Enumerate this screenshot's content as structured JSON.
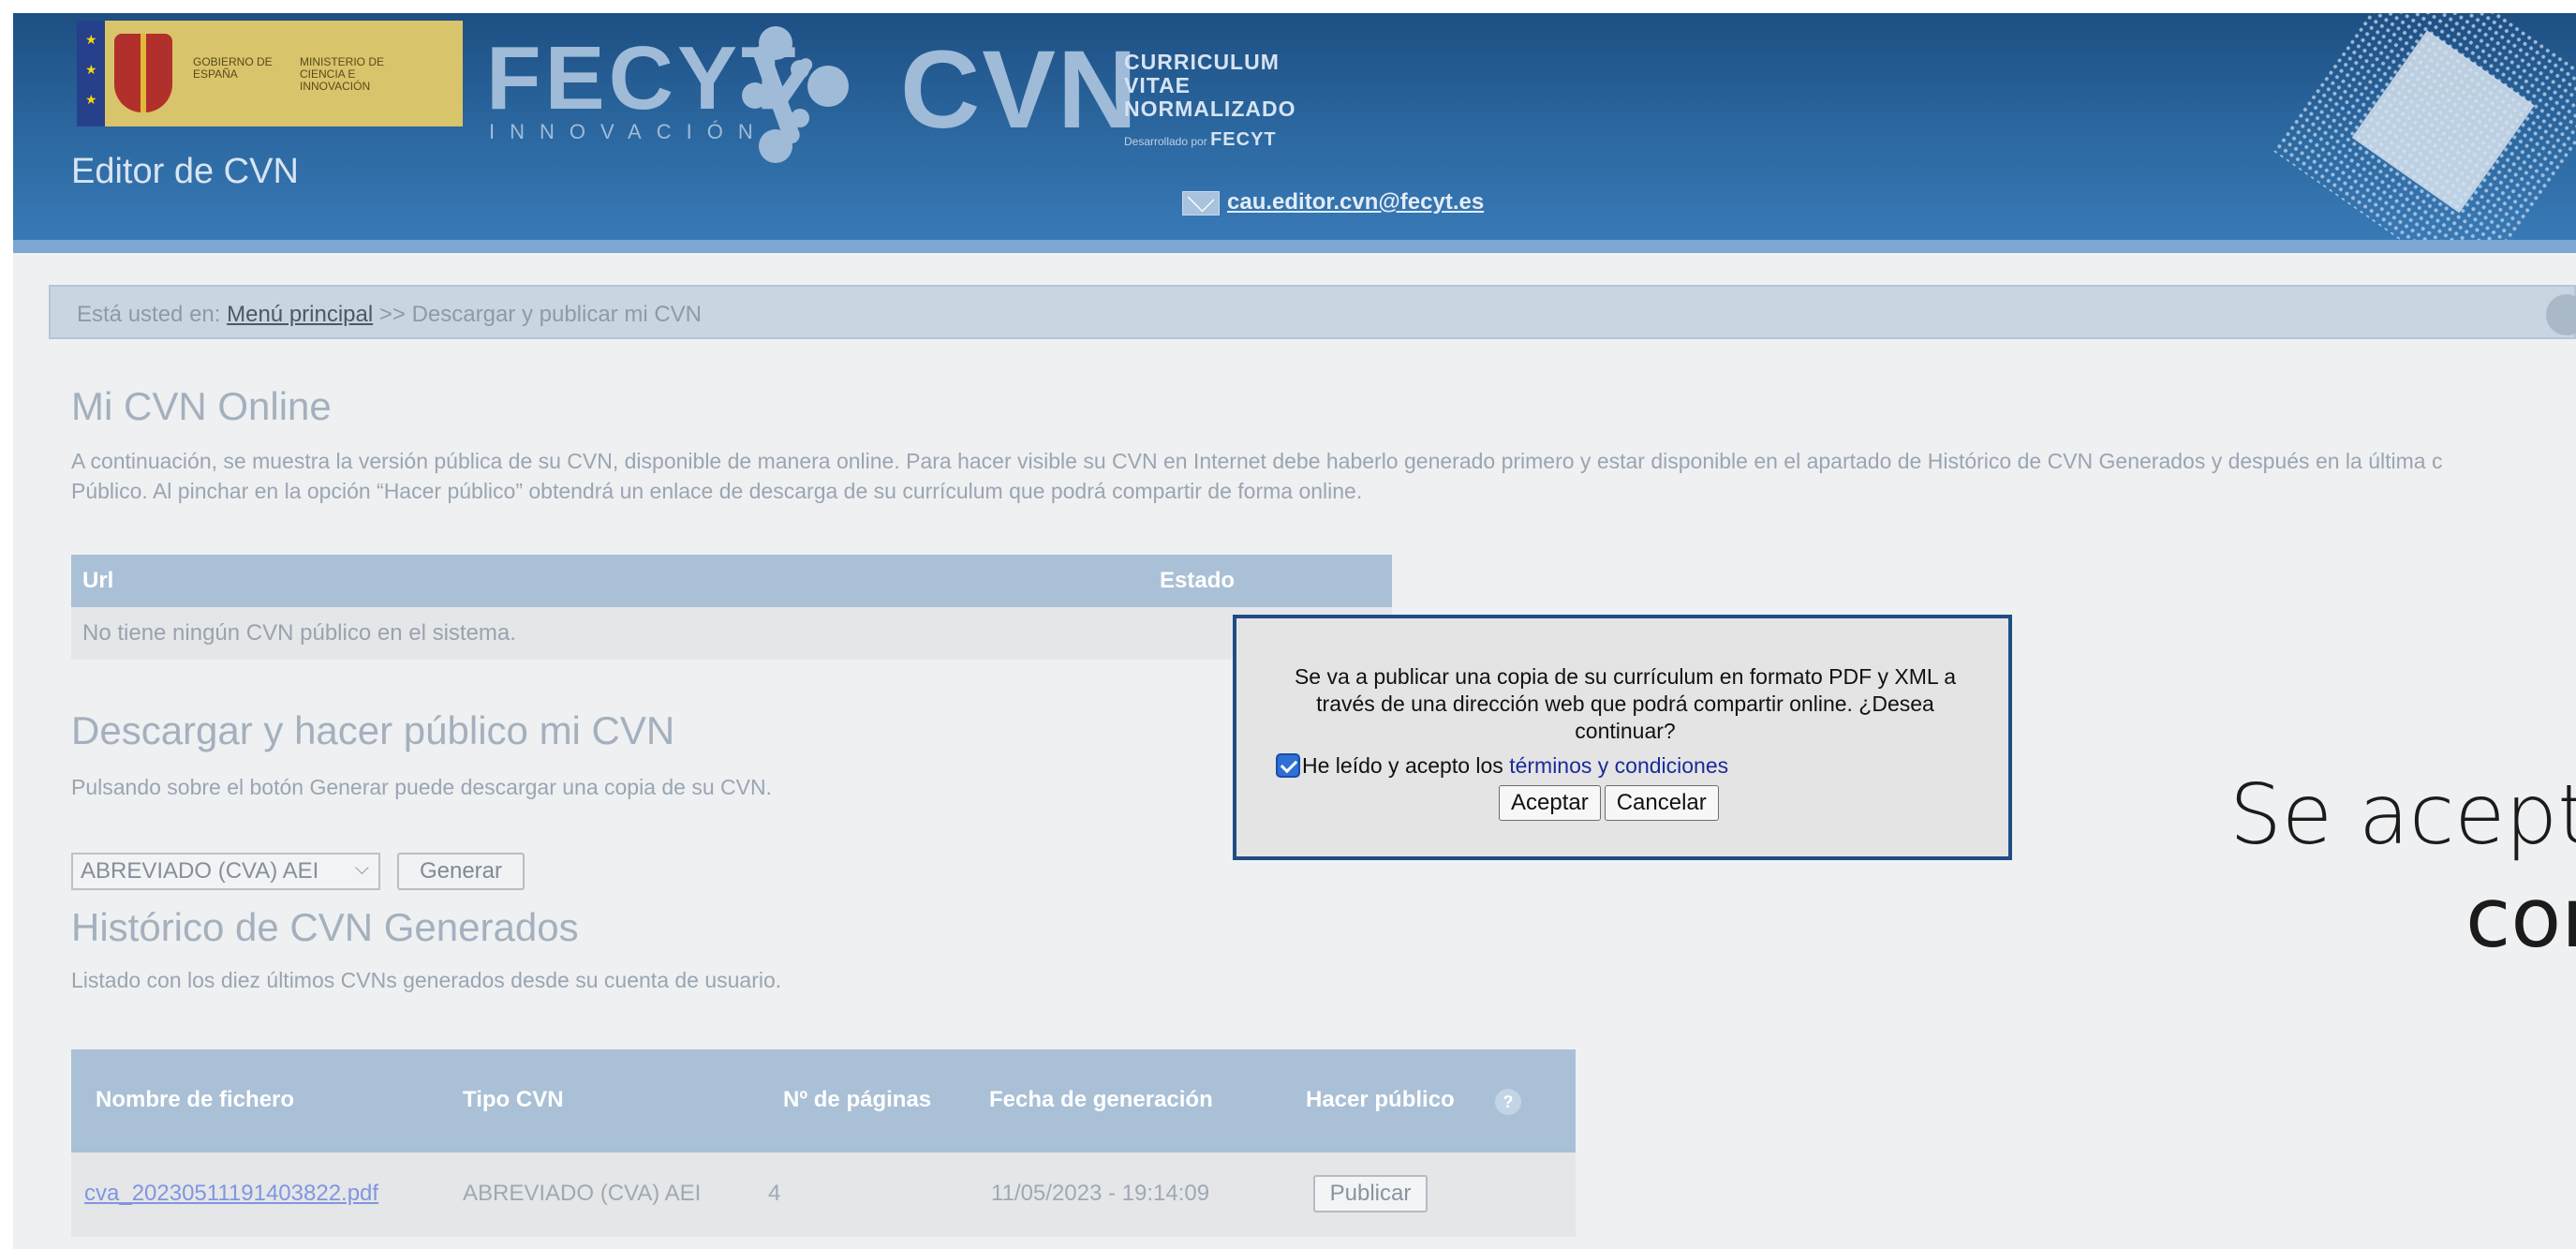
{
  "header": {
    "gov_logo_line1": "GOBIERNO DE ESPAÑA",
    "gov_logo_line2": "MINISTERIO DE CIENCIA E INNOVACIÓN",
    "fecyt": "FECYT",
    "fecyt_sub": "INNOVACIÓN",
    "cvn": "CVN",
    "cvn_words": [
      "CURRICULUM",
      "VITAE",
      "NORMALIZADO"
    ],
    "cvn_dev_prefix": "Desarrollado por",
    "cvn_dev_brand": "FECYT",
    "editor_title": "Editor de CVN",
    "email": "cau.editor.cvn@fecyt.es"
  },
  "breadcrumb": {
    "prefix": "Está usted en:",
    "home": "Menú principal",
    "current": ">> Descargar y publicar mi CVN"
  },
  "online": {
    "title": "Mi CVN Online",
    "desc_line1": "A continuación, se muestra la versión pública de su CVN, disponible de manera online. Para hacer visible su CVN en Internet debe haberlo generado primero y estar disponible en el apartado de Histórico de CVN Generados y después en la última c",
    "desc_line2": "Público. Al pinchar en la opción “Hacer público” obtendrá un enlace de descarga de su currículum que podrá compartir de forma online.",
    "col_url": "Url",
    "col_estado": "Estado",
    "empty": "No tiene ningún CVN público en el sistema."
  },
  "download": {
    "title": "Descargar y hacer público mi CVN",
    "desc": "Pulsando sobre el botón Generar puede descargar una copia de su CVN.",
    "selected": "ABREVIADO (CVA) AEI",
    "generate": "Generar"
  },
  "history": {
    "title": "Histórico de CVN Generados",
    "desc": "Listado con los diez últimos CVNs generados desde su cuenta de usuario.",
    "columns": [
      "Nombre de fichero",
      "Tipo CVN",
      "Nº de páginas",
      "Fecha de generación",
      "Hacer público"
    ],
    "help": "?",
    "rows": [
      {
        "file": "cva_20230511191403822.pdf",
        "type": "ABREVIADO (CVA) AEI",
        "pages": "4",
        "date": "11/05/2023 - 19:14:09",
        "action": "Publicar"
      }
    ]
  },
  "modal": {
    "message": "Se va a publicar una copia de su currículum en formato PDF y XML a través de una dirección web que podrá compartir online. ¿Desea continuar?",
    "terms_prefix": "He leído y acepto los",
    "terms_link": "términos y condiciones",
    "terms_checked": true,
    "accept": "Aceptar",
    "cancel": "Cancelar"
  },
  "overlay_caption": {
    "line1": "Se aceptar",
    "line2": "con"
  },
  "colors": {
    "header_blue": "#1d4f83",
    "table_header": "#a9c0d6",
    "modal_border": "#1f4c86",
    "checkbox": "#2e6fd6"
  }
}
